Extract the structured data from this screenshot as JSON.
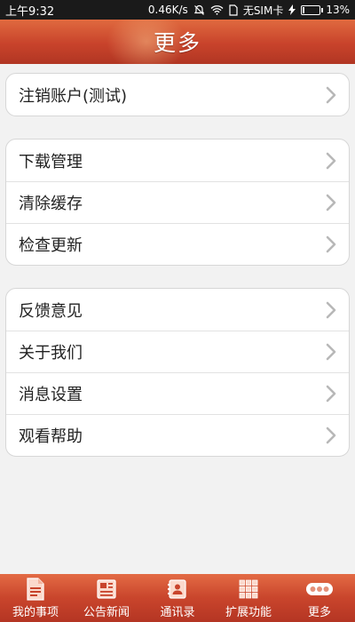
{
  "status_bar": {
    "time": "上午9:32",
    "network_speed": "0.46K/s",
    "carrier": "无SIM卡",
    "battery": "13%",
    "battery_level": 0.13
  },
  "header": {
    "title": "更多"
  },
  "groups": [
    {
      "items": [
        {
          "label": "注销账户(测试)",
          "icon": "chevron-right-icon"
        }
      ]
    },
    {
      "items": [
        {
          "label": "下载管理",
          "icon": "chevron-right-icon"
        },
        {
          "label": "清除缓存",
          "icon": "chevron-right-icon"
        },
        {
          "label": "检查更新",
          "icon": "chevron-right-icon"
        }
      ]
    },
    {
      "items": [
        {
          "label": "反馈意见",
          "icon": "chevron-right-icon"
        },
        {
          "label": "关于我们",
          "icon": "chevron-right-icon"
        },
        {
          "label": "消息设置",
          "icon": "chevron-right-icon"
        },
        {
          "label": "观看帮助",
          "icon": "chevron-right-icon"
        }
      ]
    }
  ],
  "bottom_nav": {
    "items": [
      {
        "label": "我的事项",
        "icon": "document-icon"
      },
      {
        "label": "公告新闻",
        "icon": "news-icon"
      },
      {
        "label": "通讯录",
        "icon": "contacts-icon"
      },
      {
        "label": "扩展功能",
        "icon": "grid-icon"
      },
      {
        "label": "更多",
        "icon": "more-dots-icon",
        "active": true
      }
    ]
  },
  "colors": {
    "accent": "#c8432b",
    "background": "#f2f2f2",
    "chevron": "#b8b8b8"
  }
}
